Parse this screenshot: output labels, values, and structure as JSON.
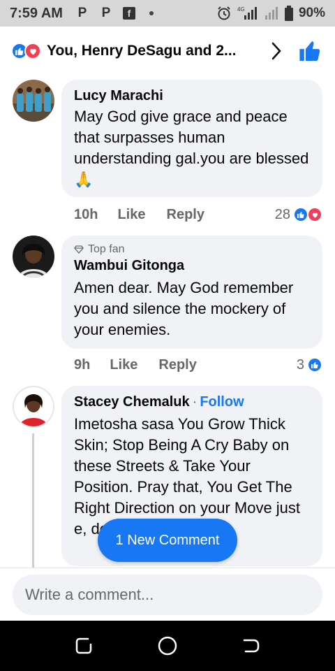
{
  "status_bar": {
    "time": "7:59 AM",
    "battery": "90%",
    "network": "4G",
    "icons": [
      "p-icon",
      "p-icon",
      "facebook-icon",
      "dot-icon",
      "alarm-icon",
      "signal-icon",
      "signal-icon",
      "battery-icon"
    ]
  },
  "header": {
    "title": "You, Henry DeSagu and 2...",
    "reactions": [
      "like",
      "love"
    ]
  },
  "comments": [
    {
      "author": "Lucy Marachi",
      "text": "May God give grace and peace that surpasses human understanding gal.you are blessed 🙏",
      "time": "10h",
      "like_label": "Like",
      "reply_label": "Reply",
      "reaction_count": "28",
      "reactions": [
        "like",
        "love"
      ]
    },
    {
      "badge": "Top fan",
      "author": "Wambui Gitonga",
      "text": "Amen dear. May God remember you and silence the mockery of your enemies.",
      "time": "9h",
      "like_label": "Like",
      "reply_label": "Reply",
      "reaction_count": "3",
      "reactions": [
        "like"
      ]
    },
    {
      "author": "Stacey Chemaluk",
      "follow_label": "Follow",
      "text": "Imetosha sasa You Grow Thick Skin; Stop Being A Cry Baby on these Streets & Take Your Position. Pray that, You Get The Right Direction on your Move just e, do it pra"
    }
  ],
  "new_comment_pill": "1 New Comment",
  "composer": {
    "placeholder": "Write a comment..."
  },
  "colors": {
    "accent": "#1877f2",
    "love": "#f33e58",
    "bubble": "#f0f2f5",
    "muted": "#65676b"
  }
}
